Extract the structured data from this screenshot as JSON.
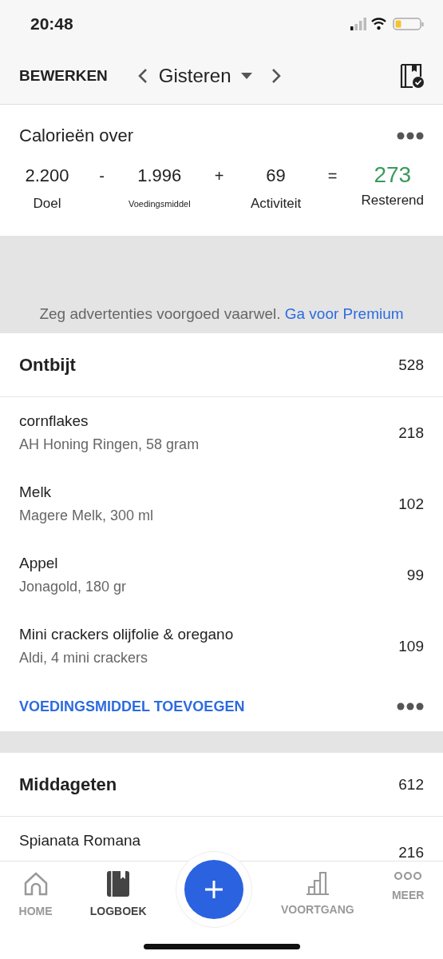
{
  "status_bar": {
    "time": "20:48"
  },
  "header": {
    "edit": "BEWERKEN",
    "date": "Gisteren"
  },
  "summary": {
    "title": "Calorieën over",
    "terms": [
      {
        "kind": "value",
        "value": "2.200",
        "label": "Doel"
      },
      {
        "kind": "operator",
        "value": "-"
      },
      {
        "kind": "value",
        "value": "1.996",
        "label": "Voedingsmiddel",
        "small": true
      },
      {
        "kind": "operator",
        "value": "+"
      },
      {
        "kind": "value",
        "value": "69",
        "label": "Activiteit"
      },
      {
        "kind": "operator",
        "value": "="
      },
      {
        "kind": "result",
        "value": "273",
        "label": "Resterend"
      }
    ]
  },
  "ad": {
    "text": "Zeg advertenties voorgoed vaarwel.",
    "link": "Ga voor Premium"
  },
  "meals": [
    {
      "name": "Ontbijt",
      "total": "528",
      "add": "VOEDINGSMIDDEL TOEVOEGEN",
      "items": [
        {
          "name": "cornflakes",
          "detail": "AH Honing Ringen, 58 gram",
          "calories": "218"
        },
        {
          "name": "Melk",
          "detail": "Magere Melk, 300 ml",
          "calories": "102"
        },
        {
          "name": "Appel",
          "detail": "Jonagold, 180 gr",
          "calories": "99"
        },
        {
          "name": "Mini crackers olijfolie & oregano",
          "detail": "Aldi, 4 mini crackers",
          "calories": "109"
        }
      ]
    },
    {
      "name": "Middageten",
      "total": "612",
      "items": [
        {
          "name": "Spianata Romana",
          "calories": "216"
        }
      ]
    }
  ],
  "tabs": [
    {
      "kind": "home",
      "label": "HOME",
      "selected": false
    },
    {
      "kind": "log",
      "label": "LOGBOEK",
      "selected": true
    },
    {
      "kind": "add"
    },
    {
      "kind": "progress",
      "label": "VOORTGANG",
      "selected": false
    },
    {
      "kind": "more",
      "label": "MEER",
      "selected": false
    }
  ]
}
